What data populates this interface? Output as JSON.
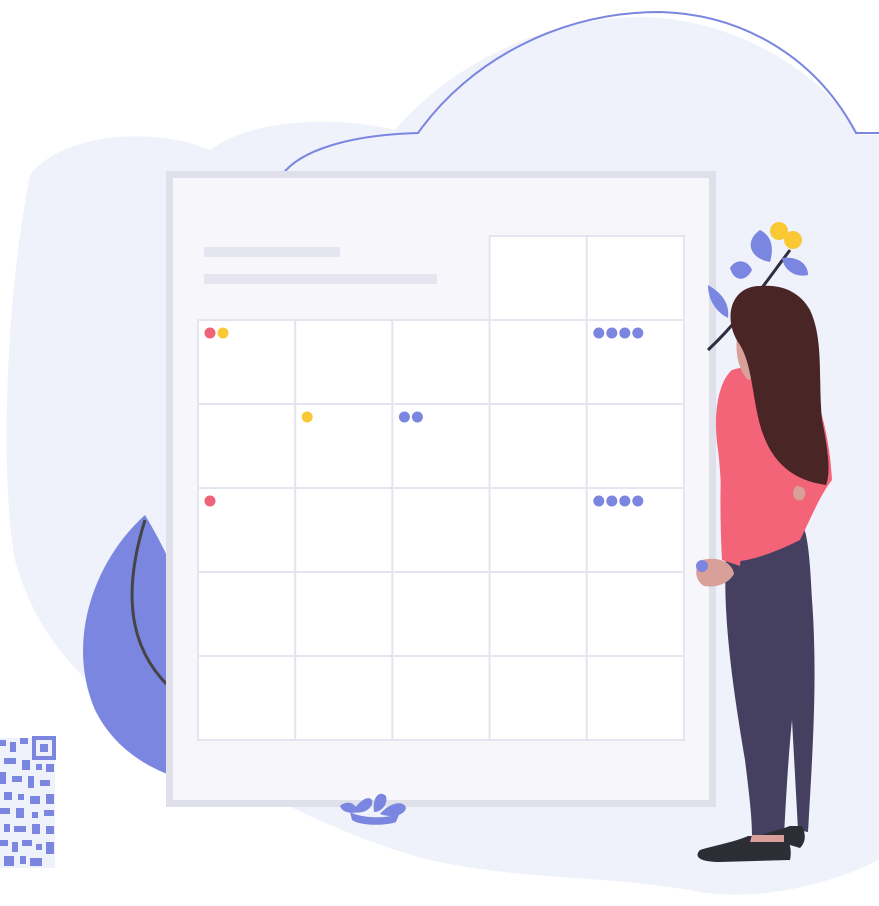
{
  "illustration": {
    "subject": "person-viewing-calendar",
    "icons": [
      "calendar-icon",
      "qr-code-icon",
      "plant-icon",
      "flower-icon"
    ]
  },
  "calendar": {
    "rows": 5,
    "columns": 5,
    "header_cells": 2,
    "markers": [
      {
        "row": 1,
        "col": 1,
        "dots": [
          "#f06277",
          "#f9c935"
        ]
      },
      {
        "row": 1,
        "col": 5,
        "dots": [
          "#7a86e0",
          "#7a86e0",
          "#7a86e0",
          "#7a86e0"
        ]
      },
      {
        "row": 2,
        "col": 2,
        "dots": [
          "#f9c935"
        ]
      },
      {
        "row": 2,
        "col": 3,
        "dots": [
          "#7a86e0",
          "#7a86e0"
        ]
      },
      {
        "row": 3,
        "col": 1,
        "dots": [
          "#f06277"
        ]
      },
      {
        "row": 3,
        "col": 5,
        "dots": [
          "#7a86e0",
          "#7a86e0",
          "#7a86e0",
          "#7a86e0"
        ]
      }
    ]
  },
  "colors": {
    "accent": "#7a86e0",
    "pink": "#f06277",
    "yellow": "#f9c935",
    "cloud": "#eff1fb",
    "board": "#f7f7fb",
    "board_frame": "#dfe0ea",
    "hair": "#4a2525",
    "shirt": "#f36478",
    "pants": "#45405f",
    "skin": "#d9a09a",
    "shoes": "#2d2d36",
    "outline": "#454545"
  }
}
